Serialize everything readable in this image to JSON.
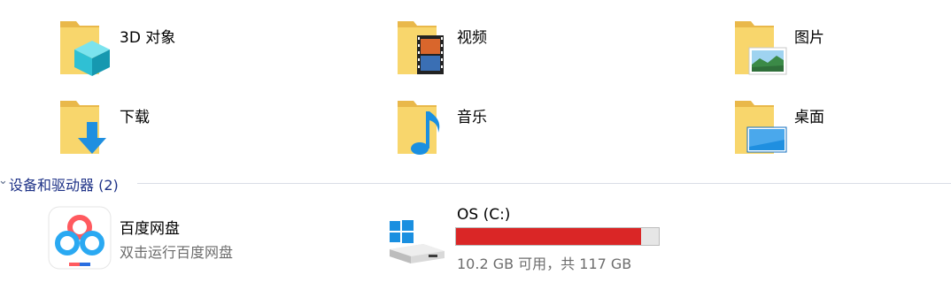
{
  "folders": [
    {
      "id": "3d",
      "label": "3D 对象",
      "icon": "3d-objects-folder-icon"
    },
    {
      "id": "video",
      "label": "视频",
      "icon": "videos-folder-icon"
    },
    {
      "id": "pictures",
      "label": "图片",
      "icon": "pictures-folder-icon"
    },
    {
      "id": "downloads",
      "label": "下载",
      "icon": "downloads-folder-icon"
    },
    {
      "id": "music",
      "label": "音乐",
      "icon": "music-folder-icon"
    },
    {
      "id": "desktop",
      "label": "桌面",
      "icon": "desktop-folder-icon"
    }
  ],
  "devices_group": {
    "title": "设备和驱动器 (2)",
    "chevron": "chevron-down-icon"
  },
  "devices": [
    {
      "id": "baidu",
      "name": "百度网盘",
      "subtitle": "双击运行百度网盘",
      "icon": "baidu-netdisk-icon"
    },
    {
      "id": "osc",
      "name": "OS (C:)",
      "subtitle": "10.2 GB 可用，共 117 GB",
      "icon": "windows-drive-icon",
      "used_fraction": 0.913,
      "bar_color": "#da2626"
    }
  ],
  "colors": {
    "group_title": "#1e3287",
    "folder_yellow": "#f5cf62",
    "accent_blue": "#1f8fe0"
  }
}
